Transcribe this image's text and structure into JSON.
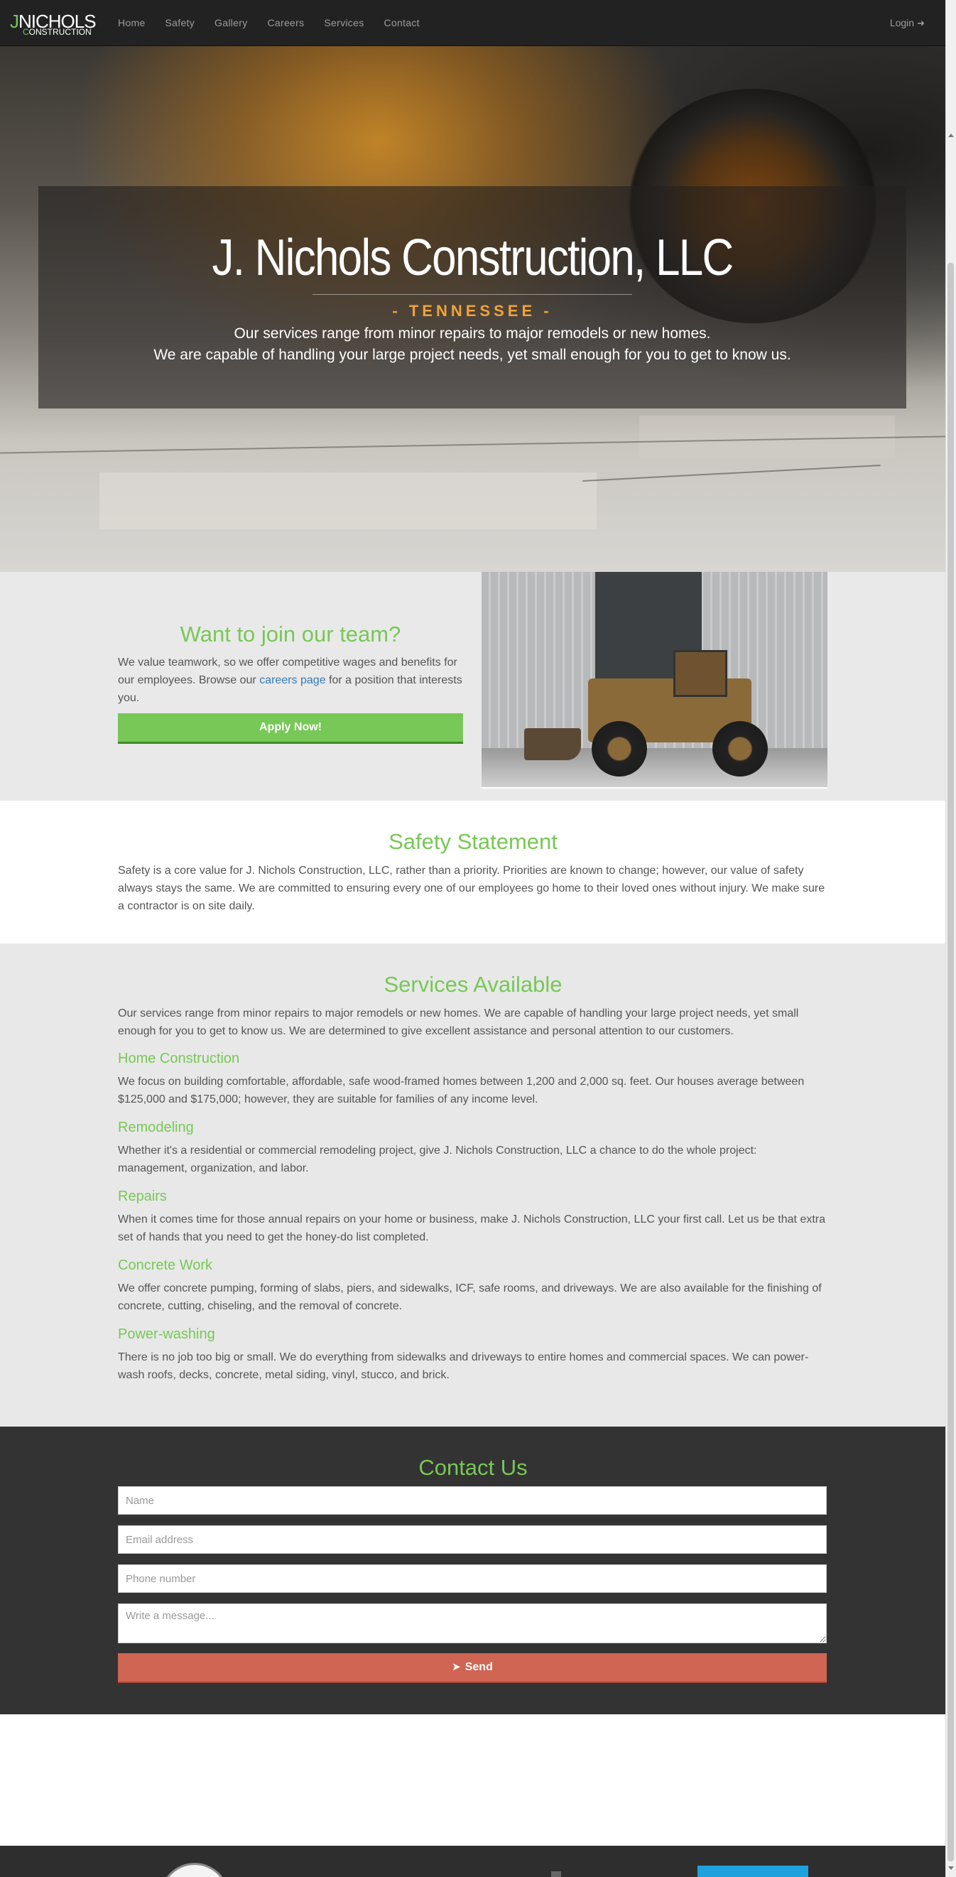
{
  "nav": {
    "logo_j": "J",
    "logo_n": "N",
    "logo_rest": "ICHOLS",
    "logo_sub_c": "C",
    "logo_sub_rest": "ONSTRUCTION",
    "links": [
      "Home",
      "Safety",
      "Gallery",
      "Careers",
      "Services",
      "Contact"
    ],
    "login_label": "Login",
    "login_icon": "sign-in-icon"
  },
  "hero": {
    "title": "J. Nichols Construction, LLC",
    "region": "- TENNESSEE -",
    "line1": "Our services range from minor repairs to major remodels or new homes.",
    "line2": "We are capable of handling your large project needs, yet small enough for you to get to know us."
  },
  "join": {
    "title": "Want to join our team?",
    "text_before": "We value teamwork, so we offer competitive wages and benefits for our employees. Browse our ",
    "link_text": "careers page",
    "text_after": " for a position that interests you.",
    "button": "Apply Now!",
    "link_color": "#337ab7"
  },
  "safety": {
    "title": "Safety Statement",
    "text": "Safety is a core value for J. Nichols Construction, LLC, rather than a priority. Priorities are known to change; however, our value of safety always stays the same. We are committed to ensuring every one of our employees go home to their loved ones without injury. We make sure a contractor is on site daily."
  },
  "services": {
    "title": "Services Available",
    "intro": "Our services range from minor repairs to major remodels or new homes. We are capable of handling your large project needs, yet small enough for you to get to know us. We are determined to give excellent assistance and personal attention to our customers.",
    "items": [
      {
        "heading": "Home Construction",
        "text": "We focus on building comfortable, affordable, safe wood-framed homes between 1,200 and 2,000 sq. feet. Our houses average between $125,000 and $175,000; however, they are suitable for families of any income level."
      },
      {
        "heading": "Remodeling",
        "text": "Whether it's a residential or commercial remodeling project, give J. Nichols Construction, LLC a chance to do the whole project: management, organization, and labor."
      },
      {
        "heading": "Repairs",
        "text": "When it comes time for those annual repairs on your home or business, make J. Nichols Construction, LLC your first call. Let us be that extra set of hands that you need to get the honey-do list completed."
      },
      {
        "heading": "Concrete Work",
        "text": "We offer concrete pumping, forming of slabs, piers, and sidewalks, ICF, safe rooms, and driveways. We are also available for the finishing of concrete, cutting, chiseling, and the removal of concrete."
      },
      {
        "heading": "Power-washing",
        "text": "There is no job too big or small. We do everything from sidewalks and driveways to entire homes and commercial spaces. We can power-wash roofs, decks, concrete, metal siding, vinyl, stucco, and brick."
      }
    ]
  },
  "contact": {
    "title": "Contact Us",
    "name_placeholder": "Name",
    "email_placeholder": "Email address",
    "phone_placeholder": "Phone number",
    "message_placeholder": "Write a message...",
    "send_label": "Send",
    "send_icon": "paper-plane-icon"
  },
  "colors": {
    "accent_green": "#77c856",
    "navbar_bg": "#222222",
    "contact_bg": "#333333",
    "send_button": "#d06553",
    "hero_region": "#f0a33a"
  }
}
